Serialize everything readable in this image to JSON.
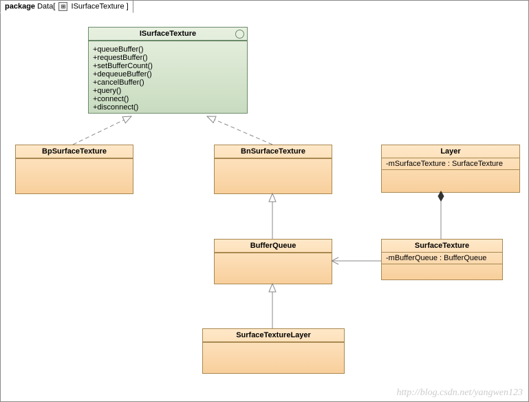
{
  "package_label": "package",
  "package_name": "Data",
  "frame_name": "ISurfaceTexture",
  "interface": {
    "name": "ISurfaceTexture",
    "methods": [
      "+queueBuffer()",
      "+requestBuffer()",
      "+setBufferCount()",
      "+dequeueBuffer()",
      "+cancelBuffer()",
      "+query()",
      "+connect()",
      "+disconnect()"
    ]
  },
  "classes": {
    "bp": {
      "name": "BpSurfaceTexture"
    },
    "bn": {
      "name": "BnSurfaceTexture"
    },
    "layer": {
      "name": "Layer",
      "attr": "-mSurfaceTexture : SurfaceTexture"
    },
    "bq": {
      "name": "BufferQueue"
    },
    "st": {
      "name": "SurfaceTexture",
      "attr": "-mBufferQueue : BufferQueue"
    },
    "stl": {
      "name": "SurfaceTextureLayer"
    }
  },
  "watermark": "http://blog.csdn.net/yangwen123",
  "relationships": [
    {
      "from": "BpSurfaceTexture",
      "to": "ISurfaceTexture",
      "type": "realization"
    },
    {
      "from": "BnSurfaceTexture",
      "to": "ISurfaceTexture",
      "type": "realization"
    },
    {
      "from": "BufferQueue",
      "to": "BnSurfaceTexture",
      "type": "generalization"
    },
    {
      "from": "SurfaceTextureLayer",
      "to": "BufferQueue",
      "type": "generalization"
    },
    {
      "from": "SurfaceTexture",
      "to": "BufferQueue",
      "type": "association"
    },
    {
      "from": "SurfaceTexture",
      "to": "Layer",
      "type": "composition-target"
    }
  ]
}
